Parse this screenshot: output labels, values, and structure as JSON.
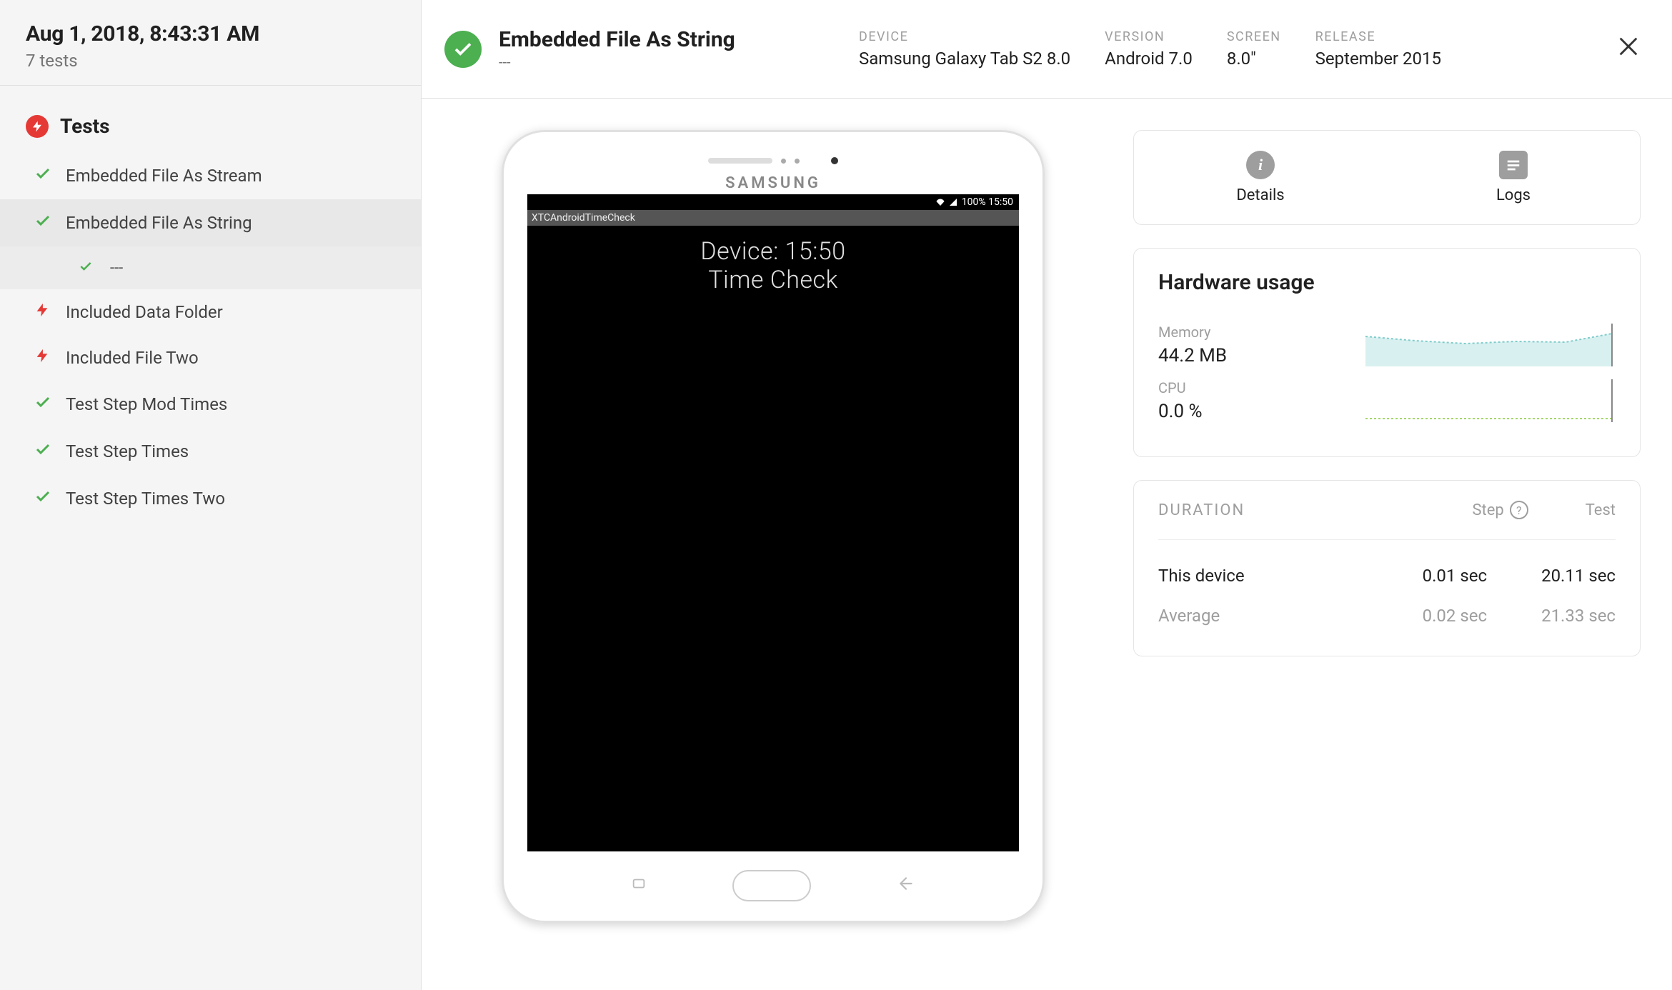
{
  "sidebar": {
    "timestamp": "Aug 1, 2018, 8:43:31 AM",
    "test_count": "7 tests",
    "heading": "Tests",
    "items": [
      {
        "status": "pass",
        "label": "Embedded File As Stream"
      },
      {
        "status": "pass",
        "label": "Embedded File As String",
        "active": true,
        "sub": {
          "label": "---"
        }
      },
      {
        "status": "fail",
        "label": "Included Data Folder"
      },
      {
        "status": "fail",
        "label": "Included File Two"
      },
      {
        "status": "pass",
        "label": "Test Step Mod Times"
      },
      {
        "status": "pass",
        "label": "Test Step Times"
      },
      {
        "status": "pass",
        "label": "Test Step Times Two"
      }
    ]
  },
  "header": {
    "test_name": "Embedded File As String",
    "subtitle": "---",
    "cols": {
      "device_label": "DEVICE",
      "device_value": "Samsung Galaxy Tab S2 8.0",
      "version_label": "VERSION",
      "version_value": "Android 7.0",
      "screen_label": "SCREEN",
      "screen_value": "8.0\"",
      "release_label": "RELEASE",
      "release_value": "September 2015"
    }
  },
  "device": {
    "brand": "SAMSUNG",
    "status_bar": "100% 15:50",
    "app_bar": "XTCAndroidTimeCheck",
    "line1": "Device: 15:50",
    "line2": "Time Check"
  },
  "tabs": {
    "details": "Details",
    "logs": "Logs"
  },
  "hardware": {
    "title": "Hardware usage",
    "memory_label": "Memory",
    "memory_value": "44.2 MB",
    "cpu_label": "CPU",
    "cpu_value": "0.0 %"
  },
  "duration": {
    "title": "DURATION",
    "step_label": "Step",
    "test_label": "Test",
    "rows": [
      {
        "label": "This device",
        "step": "0.01 sec",
        "test": "20.11 sec"
      },
      {
        "label": "Average",
        "step": "0.02 sec",
        "test": "21.33 sec"
      }
    ]
  },
  "chart_data": [
    {
      "type": "area",
      "name": "Memory sparkline",
      "x": [
        0,
        0.2,
        0.4,
        0.6,
        0.8,
        1.0
      ],
      "values": [
        44,
        42,
        41,
        42,
        42,
        45
      ],
      "ylim": [
        0,
        60
      ],
      "stroke": "#7fcccc",
      "fill": "#d9f0f0"
    },
    {
      "type": "line",
      "name": "CPU sparkline",
      "x": [
        0,
        1
      ],
      "values": [
        0,
        0
      ],
      "ylim": [
        0,
        100
      ],
      "stroke": "#a5d66a"
    }
  ]
}
